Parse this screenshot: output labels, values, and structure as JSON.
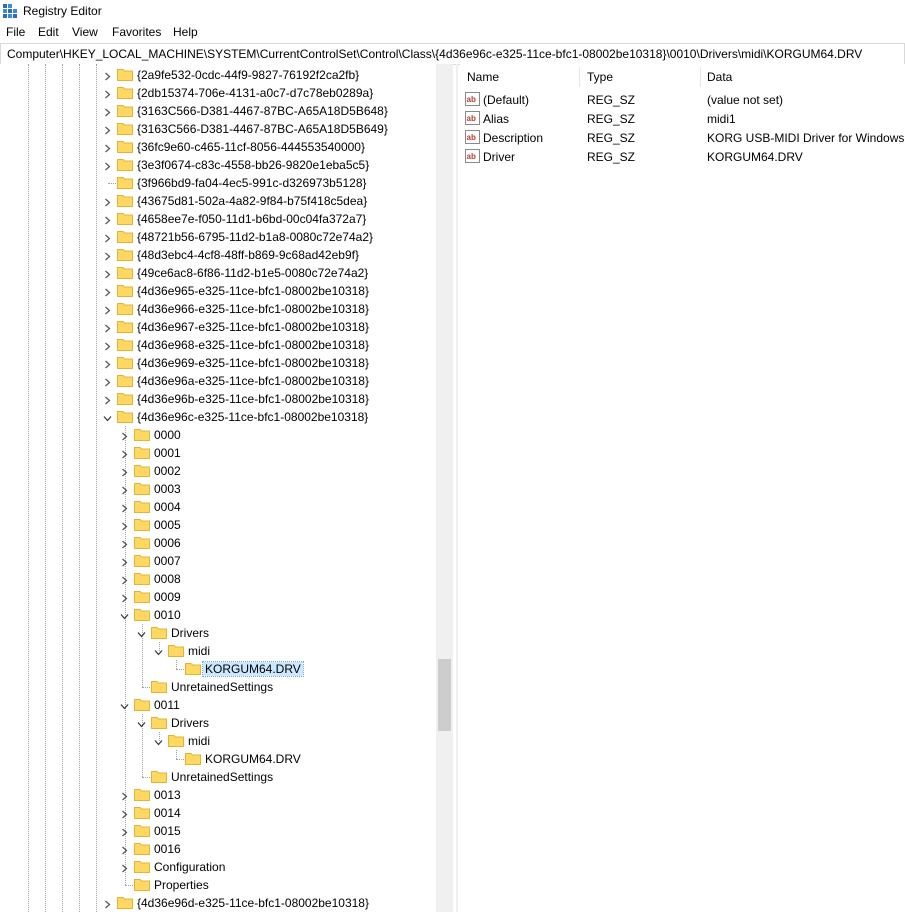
{
  "window": {
    "title": "Registry Editor",
    "icon": "registry-icon"
  },
  "menu": [
    "File",
    "Edit",
    "View",
    "Favorites",
    "Help"
  ],
  "address": "Computer\\HKEY_LOCAL_MACHINE\\SYSTEM\\CurrentControlSet\\Control\\Class\\{4d36e96c-e325-11ce-bfc1-08002be10318}\\0010\\Drivers\\midi\\KORGUM64.DRV",
  "tree": [
    {
      "label": "{2a9fe532-0cdc-44f9-9827-76192f2ca2fb}",
      "depth": 0,
      "expander": "collapsed"
    },
    {
      "label": "{2db15374-706e-4131-a0c7-d7c78eb0289a}",
      "depth": 0,
      "expander": "collapsed"
    },
    {
      "label": "{3163C566-D381-4467-87BC-A65A18D5B648}",
      "depth": 0,
      "expander": "collapsed"
    },
    {
      "label": "{3163C566-D381-4467-87BC-A65A18D5B649}",
      "depth": 0,
      "expander": "collapsed"
    },
    {
      "label": "{36fc9e60-c465-11cf-8056-444553540000}",
      "depth": 0,
      "expander": "collapsed"
    },
    {
      "label": "{3e3f0674-c83c-4558-bb26-9820e1eba5c5}",
      "depth": 0,
      "expander": "collapsed"
    },
    {
      "label": "{3f966bd9-fa04-4ec5-991c-d326973b5128}",
      "depth": 0,
      "expander": "none"
    },
    {
      "label": "{43675d81-502a-4a82-9f84-b75f418c5dea}",
      "depth": 0,
      "expander": "collapsed"
    },
    {
      "label": "{4658ee7e-f050-11d1-b6bd-00c04fa372a7}",
      "depth": 0,
      "expander": "collapsed"
    },
    {
      "label": "{48721b56-6795-11d2-b1a8-0080c72e74a2}",
      "depth": 0,
      "expander": "collapsed"
    },
    {
      "label": "{48d3ebc4-4cf8-48ff-b869-9c68ad42eb9f}",
      "depth": 0,
      "expander": "collapsed"
    },
    {
      "label": "{49ce6ac8-6f86-11d2-b1e5-0080c72e74a2}",
      "depth": 0,
      "expander": "collapsed"
    },
    {
      "label": "{4d36e965-e325-11ce-bfc1-08002be10318}",
      "depth": 0,
      "expander": "collapsed"
    },
    {
      "label": "{4d36e966-e325-11ce-bfc1-08002be10318}",
      "depth": 0,
      "expander": "collapsed"
    },
    {
      "label": "{4d36e967-e325-11ce-bfc1-08002be10318}",
      "depth": 0,
      "expander": "collapsed"
    },
    {
      "label": "{4d36e968-e325-11ce-bfc1-08002be10318}",
      "depth": 0,
      "expander": "collapsed"
    },
    {
      "label": "{4d36e969-e325-11ce-bfc1-08002be10318}",
      "depth": 0,
      "expander": "collapsed"
    },
    {
      "label": "{4d36e96a-e325-11ce-bfc1-08002be10318}",
      "depth": 0,
      "expander": "collapsed"
    },
    {
      "label": "{4d36e96b-e325-11ce-bfc1-08002be10318}",
      "depth": 0,
      "expander": "collapsed"
    },
    {
      "label": "{4d36e96c-e325-11ce-bfc1-08002be10318}",
      "depth": 0,
      "expander": "expanded"
    },
    {
      "label": "0000",
      "depth": 1,
      "expander": "collapsed"
    },
    {
      "label": "0001",
      "depth": 1,
      "expander": "collapsed"
    },
    {
      "label": "0002",
      "depth": 1,
      "expander": "collapsed"
    },
    {
      "label": "0003",
      "depth": 1,
      "expander": "collapsed"
    },
    {
      "label": "0004",
      "depth": 1,
      "expander": "collapsed"
    },
    {
      "label": "0005",
      "depth": 1,
      "expander": "collapsed"
    },
    {
      "label": "0006",
      "depth": 1,
      "expander": "collapsed"
    },
    {
      "label": "0007",
      "depth": 1,
      "expander": "collapsed"
    },
    {
      "label": "0008",
      "depth": 1,
      "expander": "collapsed"
    },
    {
      "label": "0009",
      "depth": 1,
      "expander": "collapsed"
    },
    {
      "label": "0010",
      "depth": 1,
      "expander": "expanded"
    },
    {
      "label": "Drivers",
      "depth": 2,
      "expander": "expanded"
    },
    {
      "label": "midi",
      "depth": 3,
      "expander": "expanded"
    },
    {
      "label": "KORGUM64.DRV",
      "depth": 4,
      "expander": "none",
      "selected": true
    },
    {
      "label": "UnretainedSettings",
      "depth": 2,
      "expander": "none"
    },
    {
      "label": "0011",
      "depth": 1,
      "expander": "expanded"
    },
    {
      "label": "Drivers",
      "depth": 2,
      "expander": "expanded"
    },
    {
      "label": "midi",
      "depth": 3,
      "expander": "expanded"
    },
    {
      "label": "KORGUM64.DRV",
      "depth": 4,
      "expander": "none"
    },
    {
      "label": "UnretainedSettings",
      "depth": 2,
      "expander": "none"
    },
    {
      "label": "0013",
      "depth": 1,
      "expander": "collapsed"
    },
    {
      "label": "0014",
      "depth": 1,
      "expander": "collapsed"
    },
    {
      "label": "0015",
      "depth": 1,
      "expander": "collapsed"
    },
    {
      "label": "0016",
      "depth": 1,
      "expander": "collapsed"
    },
    {
      "label": "Configuration",
      "depth": 1,
      "expander": "collapsed"
    },
    {
      "label": "Properties",
      "depth": 1,
      "expander": "none"
    },
    {
      "label": "{4d36e96d-e325-11ce-bfc1-08002be10318}",
      "depth": 0,
      "expander": "collapsed"
    }
  ],
  "values": {
    "columns": [
      "Name",
      "Type",
      "Data"
    ],
    "rows": [
      {
        "name": "(Default)",
        "type": "REG_SZ",
        "data": "(value not set)",
        "icon": "string-value-icon"
      },
      {
        "name": "Alias",
        "type": "REG_SZ",
        "data": "midi1",
        "icon": "string-value-icon"
      },
      {
        "name": "Description",
        "type": "REG_SZ",
        "data": "KORG USB-MIDI Driver for Windows",
        "icon": "string-value-icon"
      },
      {
        "name": "Driver",
        "type": "REG_SZ",
        "data": "KORGUM64.DRV",
        "icon": "string-value-icon"
      }
    ]
  },
  "colors": {
    "folder": "#ffd862",
    "folder_edge": "#e0b43a",
    "selection": "#cce8ff"
  }
}
